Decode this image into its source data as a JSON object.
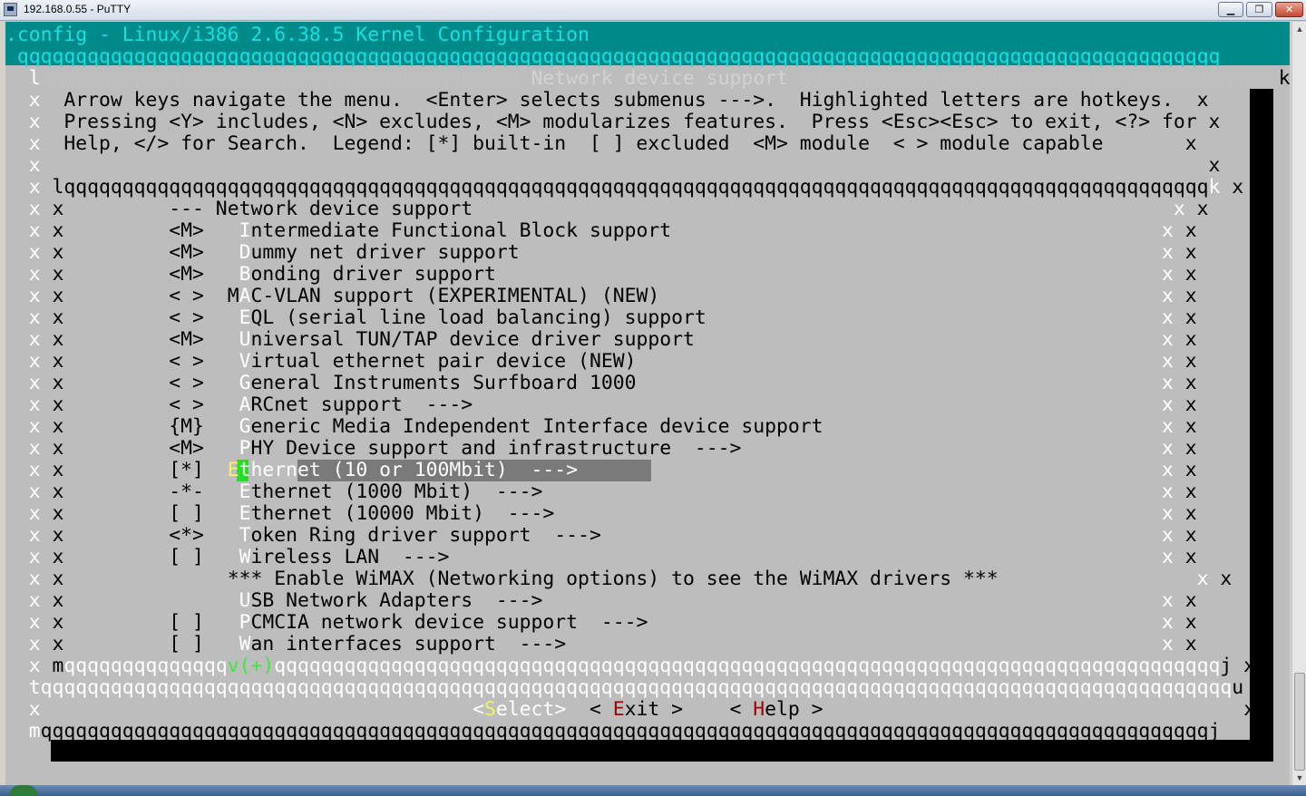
{
  "window": {
    "title": "192.168.0.55 - PuTTY"
  },
  "terminal": {
    "rows": [
      {
        "segs": [
          [
            "t-cyan",
            ".config - Linux/i386 2.6.38.5 Kernel Configuration"
          ]
        ]
      },
      {
        "segs": [
          [
            "t-cyan",
            " qqqqqqqqqqqqqqqqqqqqqqqqqqqqqqqqqqqqqqqqqqqqqqqqqqqqqqqqqqqqqqqqqqqqqqqqqqqqqqqqqqqqqqqqqqqqqqqqqqqqqqq"
          ]
        ]
      },
      {
        "segs": [
          [
            "t-white",
            "  l"
          ],
          [
            "t-gray",
            "qqqqqqqqqqqqqqqqqqqqqqqqqqqqqqqqqqqqqqqqq"
          ],
          [
            "t-dim",
            " Network device support "
          ],
          [
            "t-gray",
            "qqqqqqqqqqqqqqqqqqqqqqqqqqqqqqqqqqqqqqqqq"
          ],
          [
            "",
            "k"
          ]
        ]
      },
      {
        "segs": [
          [
            "t-white",
            "  x"
          ],
          [
            "",
            "  Arrow keys navigate the menu.  <Enter> selects submenus --->.  Highlighted letters are hotkeys.  "
          ],
          [
            "",
            "x"
          ]
        ]
      },
      {
        "segs": [
          [
            "t-white",
            "  x"
          ],
          [
            "",
            "  Pressing <Y> includes, <N> excludes, <M> modularizes features.  Press <Esc><Esc> to exit, <?> for "
          ],
          [
            "",
            "x"
          ]
        ]
      },
      {
        "segs": [
          [
            "t-white",
            "  x"
          ],
          [
            "",
            "  Help, </> for Search.  Legend: [*] built-in  [ ] excluded  <M> module  < > module capable       "
          ],
          [
            "",
            "x"
          ]
        ]
      },
      {
        "segs": [
          [
            "t-white",
            "  x"
          ],
          [
            "",
            "                                                                                                    "
          ],
          [
            "",
            "x"
          ]
        ]
      },
      {
        "segs": [
          [
            "t-white",
            "  x "
          ],
          [
            "",
            "lqqqqqqqqqqqqqqqqqqqqqqqqqqqqqqqqqqqqqqqqqqqqqqqqqqqqqqqqqqqqqqqqqqqqqqqqqqqqqqqqqqqqqqqqqqqqqqqqqq"
          ],
          [
            "t-white",
            "k"
          ],
          [
            "",
            " x"
          ]
        ]
      },
      {
        "segs": [
          [
            "t-white",
            "  x "
          ],
          [
            "",
            "x         --- Network device support                                                            "
          ],
          [
            "t-white",
            "x"
          ],
          [
            "",
            " x"
          ]
        ]
      },
      {
        "segs": [
          [
            "t-white",
            "  x "
          ],
          [
            "",
            "x         <M>   "
          ],
          [
            "t-white",
            "I"
          ],
          [
            "",
            "ntermediate Functional Block support                                          "
          ],
          [
            "t-white",
            "x"
          ],
          [
            "",
            " x"
          ]
        ]
      },
      {
        "segs": [
          [
            "t-white",
            "  x "
          ],
          [
            "",
            "x         <M>   "
          ],
          [
            "t-white",
            "D"
          ],
          [
            "",
            "ummy net driver support                                                       "
          ],
          [
            "t-white",
            "x"
          ],
          [
            "",
            " x"
          ]
        ]
      },
      {
        "segs": [
          [
            "t-white",
            "  x "
          ],
          [
            "",
            "x         <M>   "
          ],
          [
            "t-white",
            "B"
          ],
          [
            "",
            "onding driver support                                                         "
          ],
          [
            "t-white",
            "x"
          ],
          [
            "",
            " x"
          ]
        ]
      },
      {
        "segs": [
          [
            "t-white",
            "  x "
          ],
          [
            "",
            "x         < >  M"
          ],
          [
            "t-white",
            "A"
          ],
          [
            "",
            "C-VLAN support (EXPERIMENTAL) (NEW)                                           "
          ],
          [
            "t-white",
            "x"
          ],
          [
            "",
            " x"
          ]
        ]
      },
      {
        "segs": [
          [
            "t-white",
            "  x "
          ],
          [
            "",
            "x         < >   "
          ],
          [
            "t-white",
            "E"
          ],
          [
            "",
            "QL (serial line load balancing) support                                       "
          ],
          [
            "t-white",
            "x"
          ],
          [
            "",
            " x"
          ]
        ]
      },
      {
        "segs": [
          [
            "t-white",
            "  x "
          ],
          [
            "",
            "x         <M>   "
          ],
          [
            "t-white",
            "U"
          ],
          [
            "",
            "niversal TUN/TAP device driver support                                        "
          ],
          [
            "t-white",
            "x"
          ],
          [
            "",
            " x"
          ]
        ]
      },
      {
        "segs": [
          [
            "t-white",
            "  x "
          ],
          [
            "",
            "x         < >   "
          ],
          [
            "t-white",
            "V"
          ],
          [
            "",
            "irtual ethernet pair device (NEW)                                             "
          ],
          [
            "t-white",
            "x"
          ],
          [
            "",
            " x"
          ]
        ]
      },
      {
        "segs": [
          [
            "t-white",
            "  x "
          ],
          [
            "",
            "x         < >   "
          ],
          [
            "t-white",
            "G"
          ],
          [
            "",
            "eneral Instruments Surfboard 1000                                             "
          ],
          [
            "t-white",
            "x"
          ],
          [
            "",
            " x"
          ]
        ]
      },
      {
        "segs": [
          [
            "t-white",
            "  x "
          ],
          [
            "",
            "x         < >   "
          ],
          [
            "t-white",
            "A"
          ],
          [
            "",
            "RCnet support  --->                                                           "
          ],
          [
            "t-white",
            "x"
          ],
          [
            "",
            " x"
          ]
        ]
      },
      {
        "segs": [
          [
            "t-white",
            "  x "
          ],
          [
            "",
            "x         {M}   "
          ],
          [
            "t-white",
            "G"
          ],
          [
            "",
            "eneric Media Independent Interface device support                             "
          ],
          [
            "t-white",
            "x"
          ],
          [
            "",
            " x"
          ]
        ]
      },
      {
        "segs": [
          [
            "t-white",
            "  x "
          ],
          [
            "",
            "x         <M>   "
          ],
          [
            "t-white",
            "P"
          ],
          [
            "",
            "HY Device support and infrastructure  --->                                    "
          ],
          [
            "t-white",
            "x"
          ],
          [
            "",
            " x"
          ]
        ]
      },
      {
        "segs": [
          [
            "t-white",
            "  x "
          ],
          [
            "",
            "x         [*]  "
          ],
          [
            "t-yellow",
            "E"
          ],
          [
            "t-hl",
            "thernet (10 or 100Mbit)  --->                                                  "
          ],
          [
            "t-white",
            "x"
          ],
          [
            "",
            " x"
          ]
        ]
      },
      {
        "segs": [
          [
            "t-white",
            "  x "
          ],
          [
            "",
            "x         -*-   "
          ],
          [
            "t-white",
            "E"
          ],
          [
            "",
            "thernet (1000 Mbit)  --->                                                     "
          ],
          [
            "t-white",
            "x"
          ],
          [
            "",
            " x"
          ]
        ]
      },
      {
        "segs": [
          [
            "t-white",
            "  x "
          ],
          [
            "",
            "x         [ ]   "
          ],
          [
            "t-white",
            "E"
          ],
          [
            "",
            "thernet (10000 Mbit)  --->                                                    "
          ],
          [
            "t-white",
            "x"
          ],
          [
            "",
            " x"
          ]
        ]
      },
      {
        "segs": [
          [
            "t-white",
            "  x "
          ],
          [
            "",
            "x         <*>   "
          ],
          [
            "t-white",
            "T"
          ],
          [
            "",
            "oken Ring driver support  --->                                                "
          ],
          [
            "t-white",
            "x"
          ],
          [
            "",
            " x"
          ]
        ]
      },
      {
        "segs": [
          [
            "t-white",
            "  x "
          ],
          [
            "",
            "x         [ ]   "
          ],
          [
            "t-white",
            "W"
          ],
          [
            "",
            "ireless LAN  --->                                                             "
          ],
          [
            "t-white",
            "x"
          ],
          [
            "",
            " x"
          ]
        ]
      },
      {
        "segs": [
          [
            "t-white",
            "  x "
          ],
          [
            "",
            "x              *** Enable WiMAX (Networking options) to see the WiMAX drivers ***                 "
          ],
          [
            "t-white",
            "x"
          ],
          [
            "",
            " x"
          ]
        ]
      },
      {
        "segs": [
          [
            "t-white",
            "  x "
          ],
          [
            "",
            "x               "
          ],
          [
            "t-white",
            "U"
          ],
          [
            "",
            "SB Network Adapters  --->                                                     "
          ],
          [
            "t-white",
            "x"
          ],
          [
            "",
            " x"
          ]
        ]
      },
      {
        "segs": [
          [
            "t-white",
            "  x "
          ],
          [
            "",
            "x         [ ]   "
          ],
          [
            "t-white",
            "P"
          ],
          [
            "",
            "CMCIA network device support  --->                                            "
          ],
          [
            "t-white",
            "x"
          ],
          [
            "",
            " x"
          ]
        ]
      },
      {
        "segs": [
          [
            "t-white",
            "  x "
          ],
          [
            "",
            "x         [ ]   "
          ],
          [
            "t-white",
            "W"
          ],
          [
            "",
            "an interfaces support  --->                                                   "
          ],
          [
            "t-white",
            "x"
          ],
          [
            "",
            " x"
          ]
        ]
      },
      {
        "segs": [
          [
            "t-white",
            "  x "
          ],
          [
            "",
            "m"
          ],
          [
            "t-white",
            "qqqqqqqqqqqqqq"
          ],
          [
            "t-green",
            "v(+)"
          ],
          [
            "t-white",
            "qqqqqqqqqqqqqqqqqqqqqqqqqqqqqqqqqqqqqqqqqqqqqqqqqqqqqqqqqqqqqqqqqqqqqqqqqqqqqqqqq"
          ],
          [
            "",
            "j"
          ],
          [
            "",
            " x"
          ]
        ]
      },
      {
        "segs": [
          [
            "t-white",
            "  tqqqqqqqqqqqqqqqqqqqqqqqqqqqqqqqqqqqqqqqqqqqqqqqqqqqqqqqqqqqqqqqqqqqqqqqqqqqqqqqqqqqqqqqqqqqqqqqqqqqqqq"
          ],
          [
            "",
            "u"
          ]
        ]
      },
      {
        "segs": [
          [
            "t-white",
            "  x"
          ],
          [
            "",
            "                                     "
          ],
          [
            "t-white",
            "<"
          ],
          [
            "t-yellow",
            "S"
          ],
          [
            "t-white",
            "elect>"
          ],
          [
            "",
            "  < "
          ],
          [
            "t-red",
            "E"
          ],
          [
            "",
            "xit >    < "
          ],
          [
            "t-red",
            "H"
          ],
          [
            "",
            "elp >                                    "
          ],
          [
            "",
            "x"
          ]
        ]
      },
      {
        "segs": [
          [
            "t-white",
            "  m"
          ],
          [
            "",
            "qqqqqqqqqqqqqqqqqqqqqqqqqqqqqqqqqqqqqqqqqqqqqqqqqqqqqqqqqqqqqqqqqqqqqqqqqqqqqqqqqqqqqqqqqqqqqqqqqqqqj"
          ]
        ]
      }
    ]
  },
  "colors": {
    "terminal_bg": "#bdbdbd",
    "title_bg": "#008a8a",
    "highlight": "#7a7a7a",
    "shadow": "#000000"
  }
}
